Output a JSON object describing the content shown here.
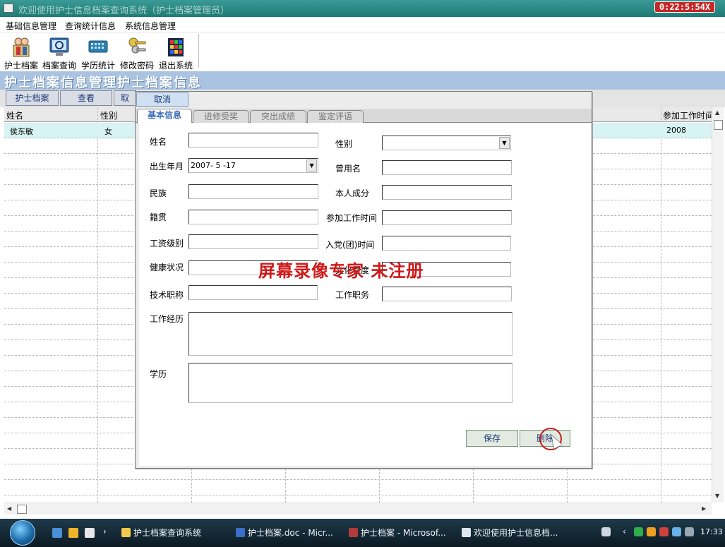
{
  "window": {
    "title": "欢迎使用护士信息档案查询系统（护士档案管理员）",
    "clock_badge": "0:22:5:54X"
  },
  "menu": {
    "items": [
      "基础信息管理",
      "查询统计信息",
      "系统信息管理"
    ]
  },
  "toolbar": {
    "items": [
      {
        "label": "护士档案",
        "icon": "nurse-file-icon"
      },
      {
        "label": "档案查询",
        "icon": "archive-query-icon"
      },
      {
        "label": "学历统计",
        "icon": "education-stats-icon"
      },
      {
        "label": "修改密码",
        "icon": "change-password-icon"
      },
      {
        "label": "退出系统",
        "icon": "exit-system-icon"
      }
    ]
  },
  "page": {
    "heading": "护士档案信息管理护士档案信息"
  },
  "subbar": {
    "buttons": [
      "护士档案",
      "查看",
      "取"
    ]
  },
  "grid": {
    "columns": [
      "姓名",
      "性别",
      "参加工作时间"
    ],
    "rows": [
      {
        "name": "侯东敏",
        "gender": "女",
        "work_start": "2008"
      }
    ]
  },
  "dialog": {
    "cancel_label": "取消",
    "tabs": [
      "基本信息",
      "进修受奖",
      "突出成绩",
      "鉴定评语"
    ],
    "fields": {
      "name_label": "姓名",
      "gender_label": "性别",
      "birth_label": "出生年月",
      "birth_value": "2007- 5 -17",
      "former_name_label": "曾用名",
      "ethnicity_label": "民族",
      "status_label": "本人成分",
      "native_label": "籍贯",
      "work_start_label": "参加工作时间",
      "salary_label": "工资级别",
      "party_label": "入党(团)时间",
      "health_label": "健康状况",
      "culture_label": "文化程度",
      "title_label": "技术职称",
      "post_label": "工作职务",
      "experience_label": "工作经历",
      "education_label": "学历"
    },
    "save_label": "保存",
    "delete_label": "删除"
  },
  "watermark": "屏幕录像专家  未注册",
  "taskbar": {
    "items": [
      {
        "label": "护士档案查询系统",
        "icon": "folder-icon"
      },
      {
        "label": "护士档案.doc - Micr...",
        "icon": "word-doc-icon"
      },
      {
        "label": "护士档案 - Microsof...",
        "icon": "access-db-icon"
      },
      {
        "label": "欢迎使用护士信息档...",
        "icon": "app-window-icon"
      }
    ],
    "time": "17:33"
  }
}
